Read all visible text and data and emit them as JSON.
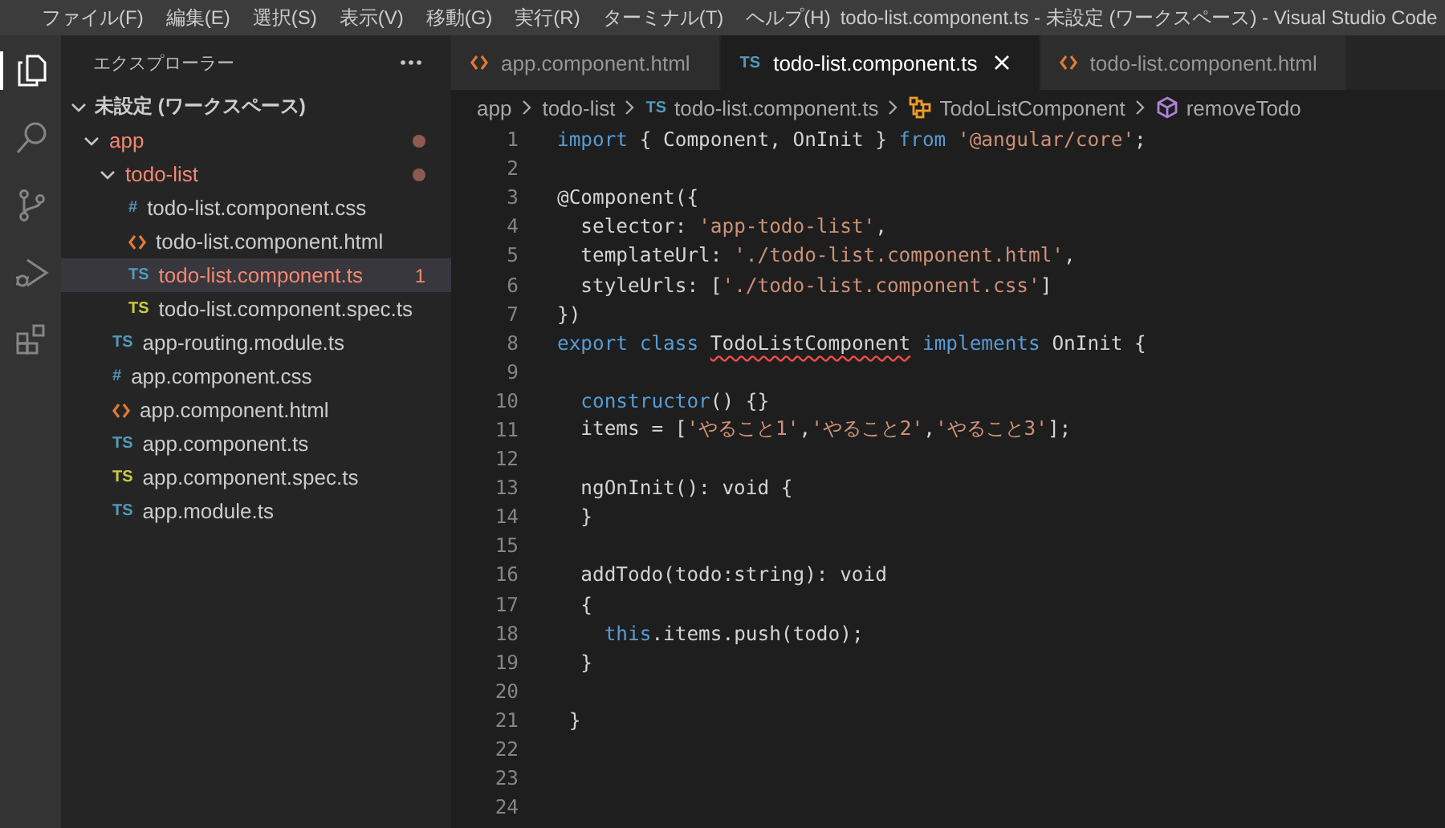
{
  "window": {
    "title": "todo-list.component.ts - 未設定 (ワークスペース) - Visual Studio Code"
  },
  "menu": [
    "ファイル(F)",
    "編集(E)",
    "選択(S)",
    "表示(V)",
    "移動(G)",
    "実行(R)",
    "ターミナル(T)",
    "ヘルプ(H)"
  ],
  "activity_bar": [
    {
      "kind": "files",
      "selected": true
    },
    {
      "kind": "search",
      "selected": false
    },
    {
      "kind": "source-control",
      "selected": false
    },
    {
      "kind": "debug",
      "selected": false
    },
    {
      "kind": "extensions",
      "selected": false
    }
  ],
  "sidebar": {
    "title": "エクスプローラー",
    "workspace": "未設定 (ワークスペース)",
    "tree": [
      {
        "label": "app",
        "kind": "folder",
        "expanded": true,
        "error": true,
        "dot": true,
        "selected": false,
        "children": [
          {
            "label": "todo-list",
            "kind": "folder",
            "expanded": true,
            "error": true,
            "dot": true,
            "selected": false,
            "children": [
              {
                "label": "todo-list.component.css",
                "kind": "css",
                "icon_text": "#",
                "error": false,
                "selected": false
              },
              {
                "label": "todo-list.component.html",
                "kind": "html",
                "error": false,
                "selected": false
              },
              {
                "label": "todo-list.component.ts",
                "kind": "ts",
                "icon_text": "TS",
                "error": true,
                "badge": "1",
                "selected": true
              },
              {
                "label": "todo-list.component.spec.ts",
                "kind": "spec",
                "icon_text": "TS",
                "error": false,
                "selected": false
              }
            ]
          },
          {
            "label": "app-routing.module.ts",
            "kind": "ts",
            "icon_text": "TS",
            "error": false,
            "selected": false
          },
          {
            "label": "app.component.css",
            "kind": "css",
            "icon_text": "#",
            "error": false,
            "selected": false
          },
          {
            "label": "app.component.html",
            "kind": "html",
            "error": false,
            "selected": false
          },
          {
            "label": "app.component.ts",
            "kind": "ts",
            "icon_text": "TS",
            "error": false,
            "selected": false
          },
          {
            "label": "app.component.spec.ts",
            "kind": "spec",
            "icon_text": "TS",
            "error": false,
            "selected": false
          },
          {
            "label": "app.module.ts",
            "kind": "ts",
            "icon_text": "TS",
            "error": false,
            "selected": false
          }
        ]
      }
    ]
  },
  "tabs": [
    {
      "label": "app.component.html",
      "kind": "html",
      "selected": false
    },
    {
      "label": "todo-list.component.ts",
      "kind": "ts",
      "icon_text": "TS",
      "selected": true
    },
    {
      "label": "todo-list.component.html",
      "kind": "html",
      "selected": false
    }
  ],
  "breadcrumb": [
    {
      "label": "app",
      "kind": "plain"
    },
    {
      "label": "todo-list",
      "kind": "plain"
    },
    {
      "label": "todo-list.component.ts",
      "kind": "ts",
      "icon_text": "TS"
    },
    {
      "label": "TodoListComponent",
      "kind": "class"
    },
    {
      "label": "removeTodo",
      "kind": "method"
    }
  ],
  "code": [
    {
      "number": "1",
      "tokens": [
        {
          "t": "import",
          "kind": "keyword"
        },
        {
          "t": " { Component, OnInit } ",
          "kind": "plain"
        },
        {
          "t": "from ",
          "kind": "keyword"
        },
        {
          "t": "'@angular/core'",
          "kind": "string"
        },
        {
          "t": ";",
          "kind": "plain"
        }
      ]
    },
    {
      "number": "2"
    },
    {
      "number": "3",
      "tokens": [
        {
          "t": "@Component({",
          "kind": "plain"
        }
      ]
    },
    {
      "number": "4",
      "tokens": [
        {
          "t": "  selector: ",
          "kind": "plain"
        },
        {
          "t": "'app-todo-list'",
          "kind": "string"
        },
        {
          "t": ",",
          "kind": "plain"
        }
      ]
    },
    {
      "number": "5",
      "tokens": [
        {
          "t": "  templateUrl: ",
          "kind": "plain"
        },
        {
          "t": "'./todo-list.component.html'",
          "kind": "string"
        },
        {
          "t": ",",
          "kind": "plain"
        }
      ]
    },
    {
      "number": "6",
      "tokens": [
        {
          "t": "  styleUrls: [",
          "kind": "plain"
        },
        {
          "t": "'./todo-list.component.css'",
          "kind": "string"
        },
        {
          "t": "]",
          "kind": "plain"
        }
      ]
    },
    {
      "number": "7",
      "tokens": [
        {
          "t": "})",
          "kind": "plain"
        }
      ]
    },
    {
      "number": "8",
      "tokens": [
        {
          "t": "export class ",
          "kind": "keyword"
        },
        {
          "t": "TodoListComponent",
          "kind": "error"
        },
        {
          "t": " implements",
          "kind": "keyword"
        },
        {
          "t": " OnInit {",
          "kind": "plain"
        }
      ]
    },
    {
      "number": "9"
    },
    {
      "number": "10",
      "tokens": [
        {
          "t": "  constructor",
          "kind": "keyword"
        },
        {
          "t": "() {}",
          "kind": "plain"
        }
      ]
    },
    {
      "number": "11",
      "tokens": [
        {
          "t": "  items = [",
          "kind": "plain"
        },
        {
          "t": "'やること1'",
          "kind": "string"
        },
        {
          "t": ",",
          "kind": "plain"
        },
        {
          "t": "'やること2'",
          "kind": "string"
        },
        {
          "t": ",",
          "kind": "plain"
        },
        {
          "t": "'やること3'",
          "kind": "string"
        },
        {
          "t": "];",
          "kind": "plain"
        }
      ]
    },
    {
      "number": "12"
    },
    {
      "number": "13",
      "tokens": [
        {
          "t": "  ngOnInit(): void {",
          "kind": "plain"
        }
      ]
    },
    {
      "number": "14",
      "tokens": [
        {
          "t": "  }",
          "kind": "plain"
        }
      ]
    },
    {
      "number": "15"
    },
    {
      "number": "16",
      "tokens": [
        {
          "t": "  addTodo(todo:string): void",
          "kind": "plain"
        }
      ]
    },
    {
      "number": "17",
      "tokens": [
        {
          "t": "  {",
          "kind": "plain"
        }
      ]
    },
    {
      "number": "18",
      "tokens": [
        {
          "t": "    this",
          "kind": "keyword"
        },
        {
          "t": ".items.push(todo);",
          "kind": "plain"
        }
      ]
    },
    {
      "number": "19",
      "tokens": [
        {
          "t": "  }",
          "kind": "plain"
        }
      ]
    },
    {
      "number": "20"
    },
    {
      "number": "21",
      "tokens": [
        {
          "t": " }",
          "kind": "plain"
        }
      ]
    },
    {
      "number": "22"
    },
    {
      "number": "23"
    },
    {
      "number": "24"
    }
  ]
}
